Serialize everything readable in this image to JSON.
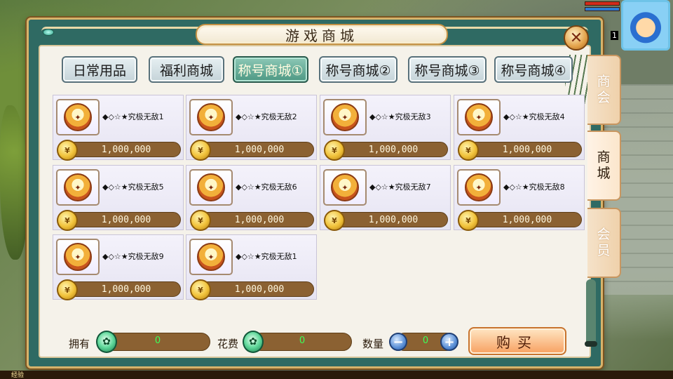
{
  "hud": {
    "level_fragment": "1"
  },
  "window": {
    "title": "游戏商城",
    "close_glyph": "✕"
  },
  "tabs": [
    {
      "label": "日常用品",
      "active": false
    },
    {
      "label": "福利商城",
      "active": false
    },
    {
      "label": "称号商城①",
      "active": true
    },
    {
      "label": "称号商城②",
      "active": false
    },
    {
      "label": "称号商城③",
      "active": false
    },
    {
      "label": "称号商城④",
      "active": false
    }
  ],
  "items": [
    {
      "name": "◆◇☆★究极无敌1",
      "price": "1,000,000"
    },
    {
      "name": "◆◇☆★究极无敌2",
      "price": "1,000,000"
    },
    {
      "name": "◆◇☆★究极无敌3",
      "price": "1,000,000"
    },
    {
      "name": "◆◇☆★究极无敌4",
      "price": "1,000,000"
    },
    {
      "name": "◆◇☆★究极无敌5",
      "price": "1,000,000"
    },
    {
      "name": "◆◇☆★究极无敌6",
      "price": "1,000,000"
    },
    {
      "name": "◆◇☆★究极无敌7",
      "price": "1,000,000"
    },
    {
      "name": "◆◇☆★究极无敌8",
      "price": "1,000,000"
    },
    {
      "name": "◆◇☆★究极无敌9",
      "price": "1,000,000"
    },
    {
      "name": "◆◇☆★究极无敌1",
      "price": "1,000,000"
    }
  ],
  "footer": {
    "owned_label": "拥有",
    "owned_value": "0",
    "cost_label": "花费",
    "cost_value": "0",
    "quantity_label": "数量",
    "quantity_value": "0",
    "minus_glyph": "−",
    "plus_glyph": "+",
    "buy_label": "购买"
  },
  "side_tabs": [
    {
      "label_top": "商",
      "label_bottom": "会",
      "active": false
    },
    {
      "label_top": "商",
      "label_bottom": "城",
      "active": true
    },
    {
      "label_top": "会",
      "label_bottom": "员",
      "active": false
    }
  ],
  "bottom_bar": {
    "exp_label": "经验"
  },
  "colors": {
    "panel_teal": "#2f6a63",
    "active_tab": "#4d9883",
    "price_bar": "#8b6132",
    "value_text_green": "#3cff5a"
  }
}
